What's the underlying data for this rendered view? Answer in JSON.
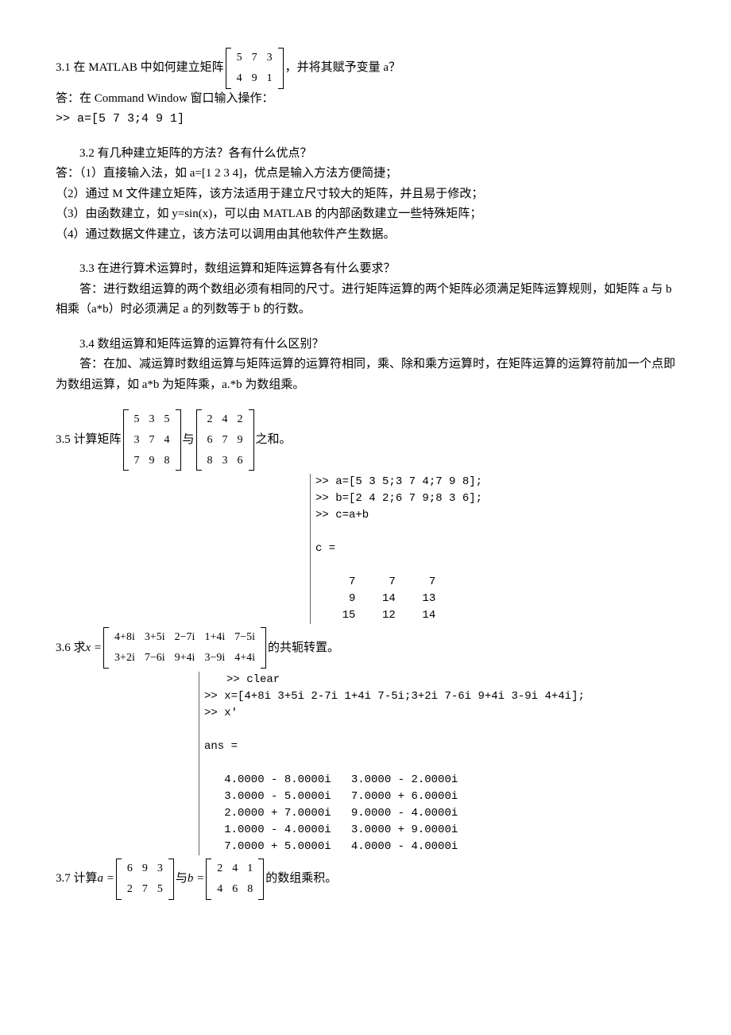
{
  "q31": {
    "prefix": "3.1  在 MATLAB 中如何建立矩阵",
    "matrix": [
      [
        "5",
        "7",
        "3"
      ],
      [
        "4",
        "9",
        "1"
      ]
    ],
    "suffix": "，并将其赋予变量 a？",
    "ans1": "答：在 Command Window 窗口输入操作：",
    "ans2": ">> a=[5 7 3;4 9 1]"
  },
  "q32": {
    "title": "3.2  有几种建立矩阵的方法？各有什么优点？",
    "l1": "答：（1）直接输入法，如 a=[1 2 3 4]，优点是输入方法方便简捷；",
    "l2": "（2）通过 M 文件建立矩阵，该方法适用于建立尺寸较大的矩阵，并且易于修改；",
    "l3": "（3）由函数建立，如 y=sin(x)，可以由 MATLAB 的内部函数建立一些特殊矩阵；",
    "l4": "（4）通过数据文件建立，该方法可以调用由其他软件产生数据。"
  },
  "q33": {
    "title": "3.3  在进行算术运算时，数组运算和矩阵运算各有什么要求？",
    "ans": "答：进行数组运算的两个数组必须有相同的尺寸。进行矩阵运算的两个矩阵必须满足矩阵运算规则，如矩阵 a 与 b 相乘（a*b）时必须满足 a 的列数等于 b 的行数。"
  },
  "q34": {
    "title": "3.4  数组运算和矩阵运算的运算符有什么区别？",
    "ans": "答：在加、减运算时数组运算与矩阵运算的运算符相同，乘、除和乘方运算时，在矩阵运算的运算符前加一个点即为数组运算，如 a*b 为矩阵乘，a.*b 为数组乘。"
  },
  "q35": {
    "prefix": "3.5  计算矩阵",
    "mA": [
      [
        "5",
        "3",
        "5"
      ],
      [
        "3",
        "7",
        "4"
      ],
      [
        "7",
        "9",
        "8"
      ]
    ],
    "mid": "与",
    "mB": [
      [
        "2",
        "4",
        "2"
      ],
      [
        "6",
        "7",
        "9"
      ],
      [
        "8",
        "3",
        "6"
      ]
    ],
    "suffix": "之和。",
    "code": ">> a=[5 3 5;3 7 4;7 9 8];\n>> b=[2 4 2;6 7 9;8 3 6];\n>> c=a+b\n\nc =\n\n     7     7     7\n     9    14    13\n    15    12    14"
  },
  "q36": {
    "prefix": "3.6  求",
    "xeq": " x = ",
    "matrix": [
      [
        "4+8i",
        "3+5i",
        "2−7i",
        "1+4i",
        "7−5i"
      ],
      [
        "3+2i",
        "7−6i",
        "9+4i",
        "3−9i",
        "4+4i"
      ]
    ],
    "suffix": "的共轭转置。",
    "code": ">> clear\n>> x=[4+8i 3+5i 2-7i 1+4i 7-5i;3+2i 7-6i 9+4i 3-9i 4+4i];\n>> x'\n\nans =\n\n   4.0000 - 8.0000i   3.0000 - 2.0000i\n   3.0000 - 5.0000i   7.0000 + 6.0000i\n   2.0000 + 7.0000i   9.0000 - 4.0000i\n   1.0000 - 4.0000i   3.0000 + 9.0000i\n   7.0000 + 5.0000i   4.0000 - 4.0000i"
  },
  "q37": {
    "prefix": "3.7  计算",
    "aeq": " a = ",
    "mA": [
      [
        "6",
        "9",
        "3"
      ],
      [
        "2",
        "7",
        "5"
      ]
    ],
    "mid": "与",
    "beq": " b = ",
    "mB": [
      [
        "2",
        "4",
        "1"
      ],
      [
        "4",
        "6",
        "8"
      ]
    ],
    "suffix": "的数组乘积。"
  }
}
